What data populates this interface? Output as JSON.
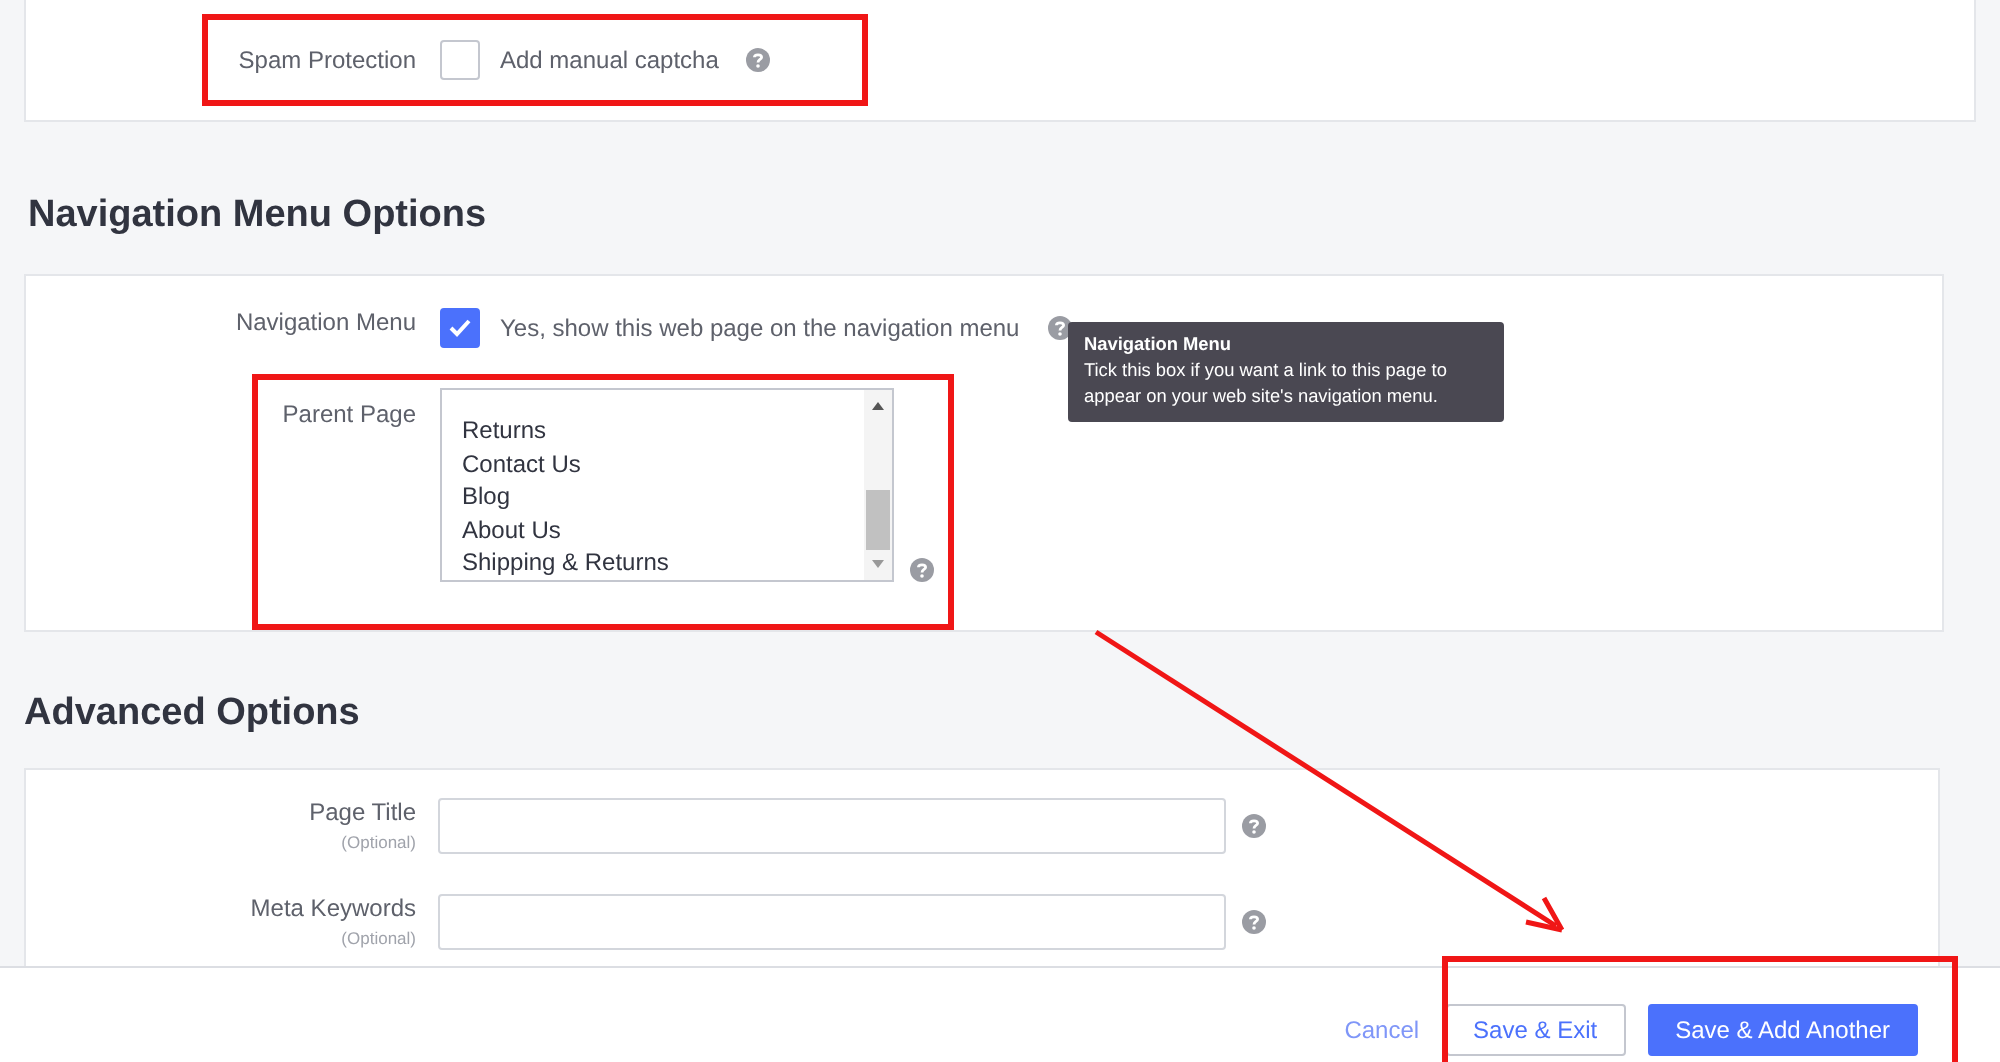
{
  "spam_protection": {
    "label": "Spam Protection",
    "checkbox": {
      "label": "Add manual captcha",
      "checked": false
    }
  },
  "navigation_section": {
    "heading": "Navigation Menu Options",
    "navigation_menu": {
      "label": "Navigation Menu",
      "checkbox": {
        "label": "Yes, show this web page on the navigation menu",
        "checked": true
      }
    },
    "tooltip": {
      "title": "Navigation Menu",
      "text": "Tick this box if you want a link to this page to appear on your web site's navigation menu."
    },
    "parent_page": {
      "label": "Parent Page",
      "options": [
        {
          "label": "Returns",
          "selected": false
        },
        {
          "label": "Contact Us",
          "selected": false
        },
        {
          "label": "Blog",
          "selected": false
        },
        {
          "label": "About Us",
          "selected": false
        },
        {
          "label": "Shipping & Returns",
          "selected": false
        }
      ]
    }
  },
  "advanced_section": {
    "heading": "Advanced Options",
    "fields": [
      {
        "label": "Page Title",
        "hint": "(Optional)"
      },
      {
        "label": "Meta Keywords",
        "hint": "(Optional)"
      }
    ]
  },
  "footer": {
    "buttons": [
      {
        "label": "Cancel",
        "kind": "link"
      },
      {
        "label": "Save & Exit",
        "kind": "secondary"
      },
      {
        "label": "Save & Add Another",
        "kind": "primary"
      }
    ]
  }
}
